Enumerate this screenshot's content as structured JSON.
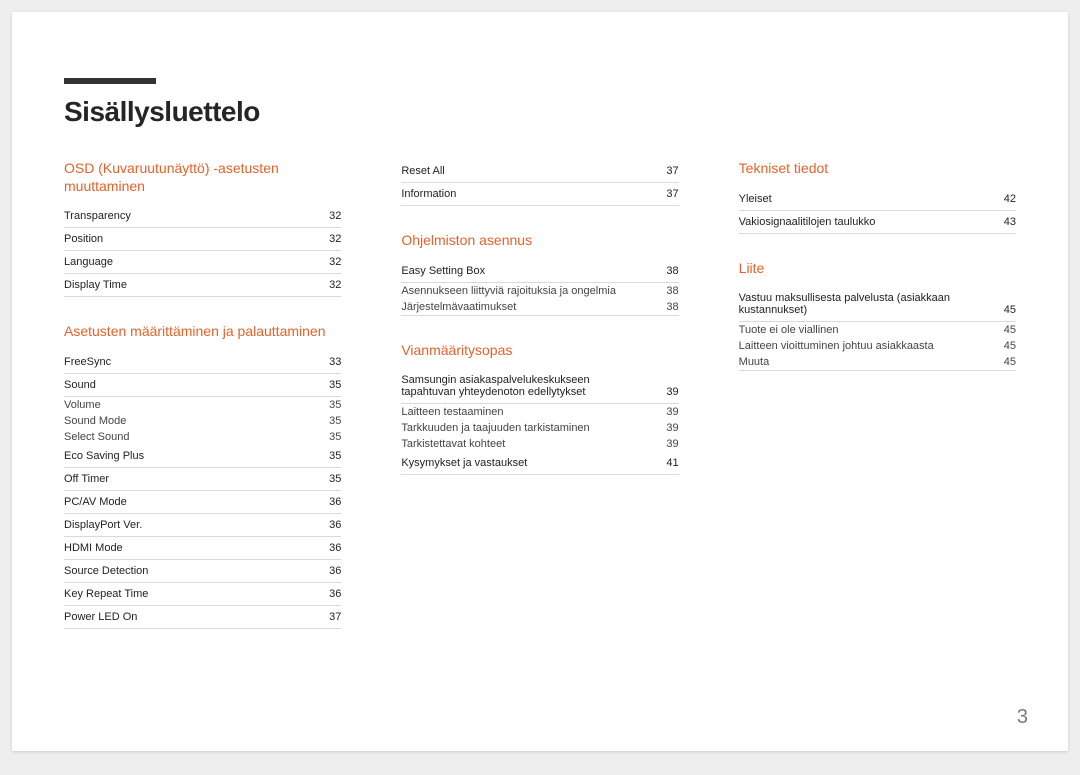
{
  "page_title": "Sisällysluettelo",
  "page_number": "3",
  "columns": [
    {
      "sections": [
        {
          "title": "OSD (Kuvaruutunäyttö) -asetusten muuttaminen",
          "entries": [
            {
              "label": "Transparency",
              "page": "32",
              "sub": false
            },
            {
              "label": "Position",
              "page": "32",
              "sub": false
            },
            {
              "label": "Language",
              "page": "32",
              "sub": false
            },
            {
              "label": "Display Time",
              "page": "32",
              "sub": false
            }
          ]
        },
        {
          "title": "Asetusten määrittäminen ja palauttaminen",
          "entries": [
            {
              "label": "FreeSync",
              "page": "33",
              "sub": false
            },
            {
              "label": "Sound",
              "page": "35",
              "sub": false
            },
            {
              "label": "Volume",
              "page": "35",
              "sub": true
            },
            {
              "label": "Sound Mode",
              "page": "35",
              "sub": true
            },
            {
              "label": "Select Sound",
              "page": "35",
              "sub": true
            },
            {
              "label": "Eco Saving Plus",
              "page": "35",
              "sub": false
            },
            {
              "label": "Off Timer",
              "page": "35",
              "sub": false
            },
            {
              "label": "PC/AV Mode",
              "page": "36",
              "sub": false
            },
            {
              "label": "DisplayPort Ver.",
              "page": "36",
              "sub": false
            },
            {
              "label": "HDMI Mode",
              "page": "36",
              "sub": false
            },
            {
              "label": "Source Detection",
              "page": "36",
              "sub": false
            },
            {
              "label": "Key Repeat Time",
              "page": "36",
              "sub": false
            },
            {
              "label": "Power LED On",
              "page": "37",
              "sub": false
            }
          ]
        }
      ]
    },
    {
      "sections": [
        {
          "title": "",
          "entries": [
            {
              "label": "Reset All",
              "page": "37",
              "sub": false
            },
            {
              "label": "Information",
              "page": "37",
              "sub": false
            }
          ]
        },
        {
          "title": "Ohjelmiston asennus",
          "entries": [
            {
              "label": "Easy Setting Box",
              "page": "38",
              "sub": false
            },
            {
              "label": "Asennukseen liittyviä rajoituksia ja ongelmia",
              "page": "38",
              "sub": true
            },
            {
              "label": "Järjestelmävaatimukset",
              "page": "38",
              "sub": true
            }
          ]
        },
        {
          "title": "Vianmääritysopas",
          "entries": [
            {
              "label": "Samsungin asiakaspalvelukeskukseen tapahtuvan yhteydenoton edellytykset",
              "page": "39",
              "sub": false
            },
            {
              "label": "Laitteen testaaminen",
              "page": "39",
              "sub": true
            },
            {
              "label": "Tarkkuuden ja taajuuden tarkistaminen",
              "page": "39",
              "sub": true
            },
            {
              "label": "Tarkistettavat kohteet",
              "page": "39",
              "sub": true
            },
            {
              "label": "Kysymykset ja vastaukset",
              "page": "41",
              "sub": false
            }
          ]
        }
      ]
    },
    {
      "sections": [
        {
          "title": "Tekniset tiedot",
          "entries": [
            {
              "label": "Yleiset",
              "page": "42",
              "sub": false
            },
            {
              "label": "Vakiosignaalitilojen taulukko",
              "page": "43",
              "sub": false
            }
          ]
        },
        {
          "title": "Liite",
          "entries": [
            {
              "label": "Vastuu maksullisesta palvelusta (asiakkaan kustannukset)",
              "page": "45",
              "sub": false
            },
            {
              "label": "Tuote ei ole viallinen",
              "page": "45",
              "sub": true
            },
            {
              "label": "Laitteen vioittuminen johtuu asiakkaasta",
              "page": "45",
              "sub": true
            },
            {
              "label": "Muuta",
              "page": "45",
              "sub": true
            }
          ]
        }
      ]
    }
  ]
}
